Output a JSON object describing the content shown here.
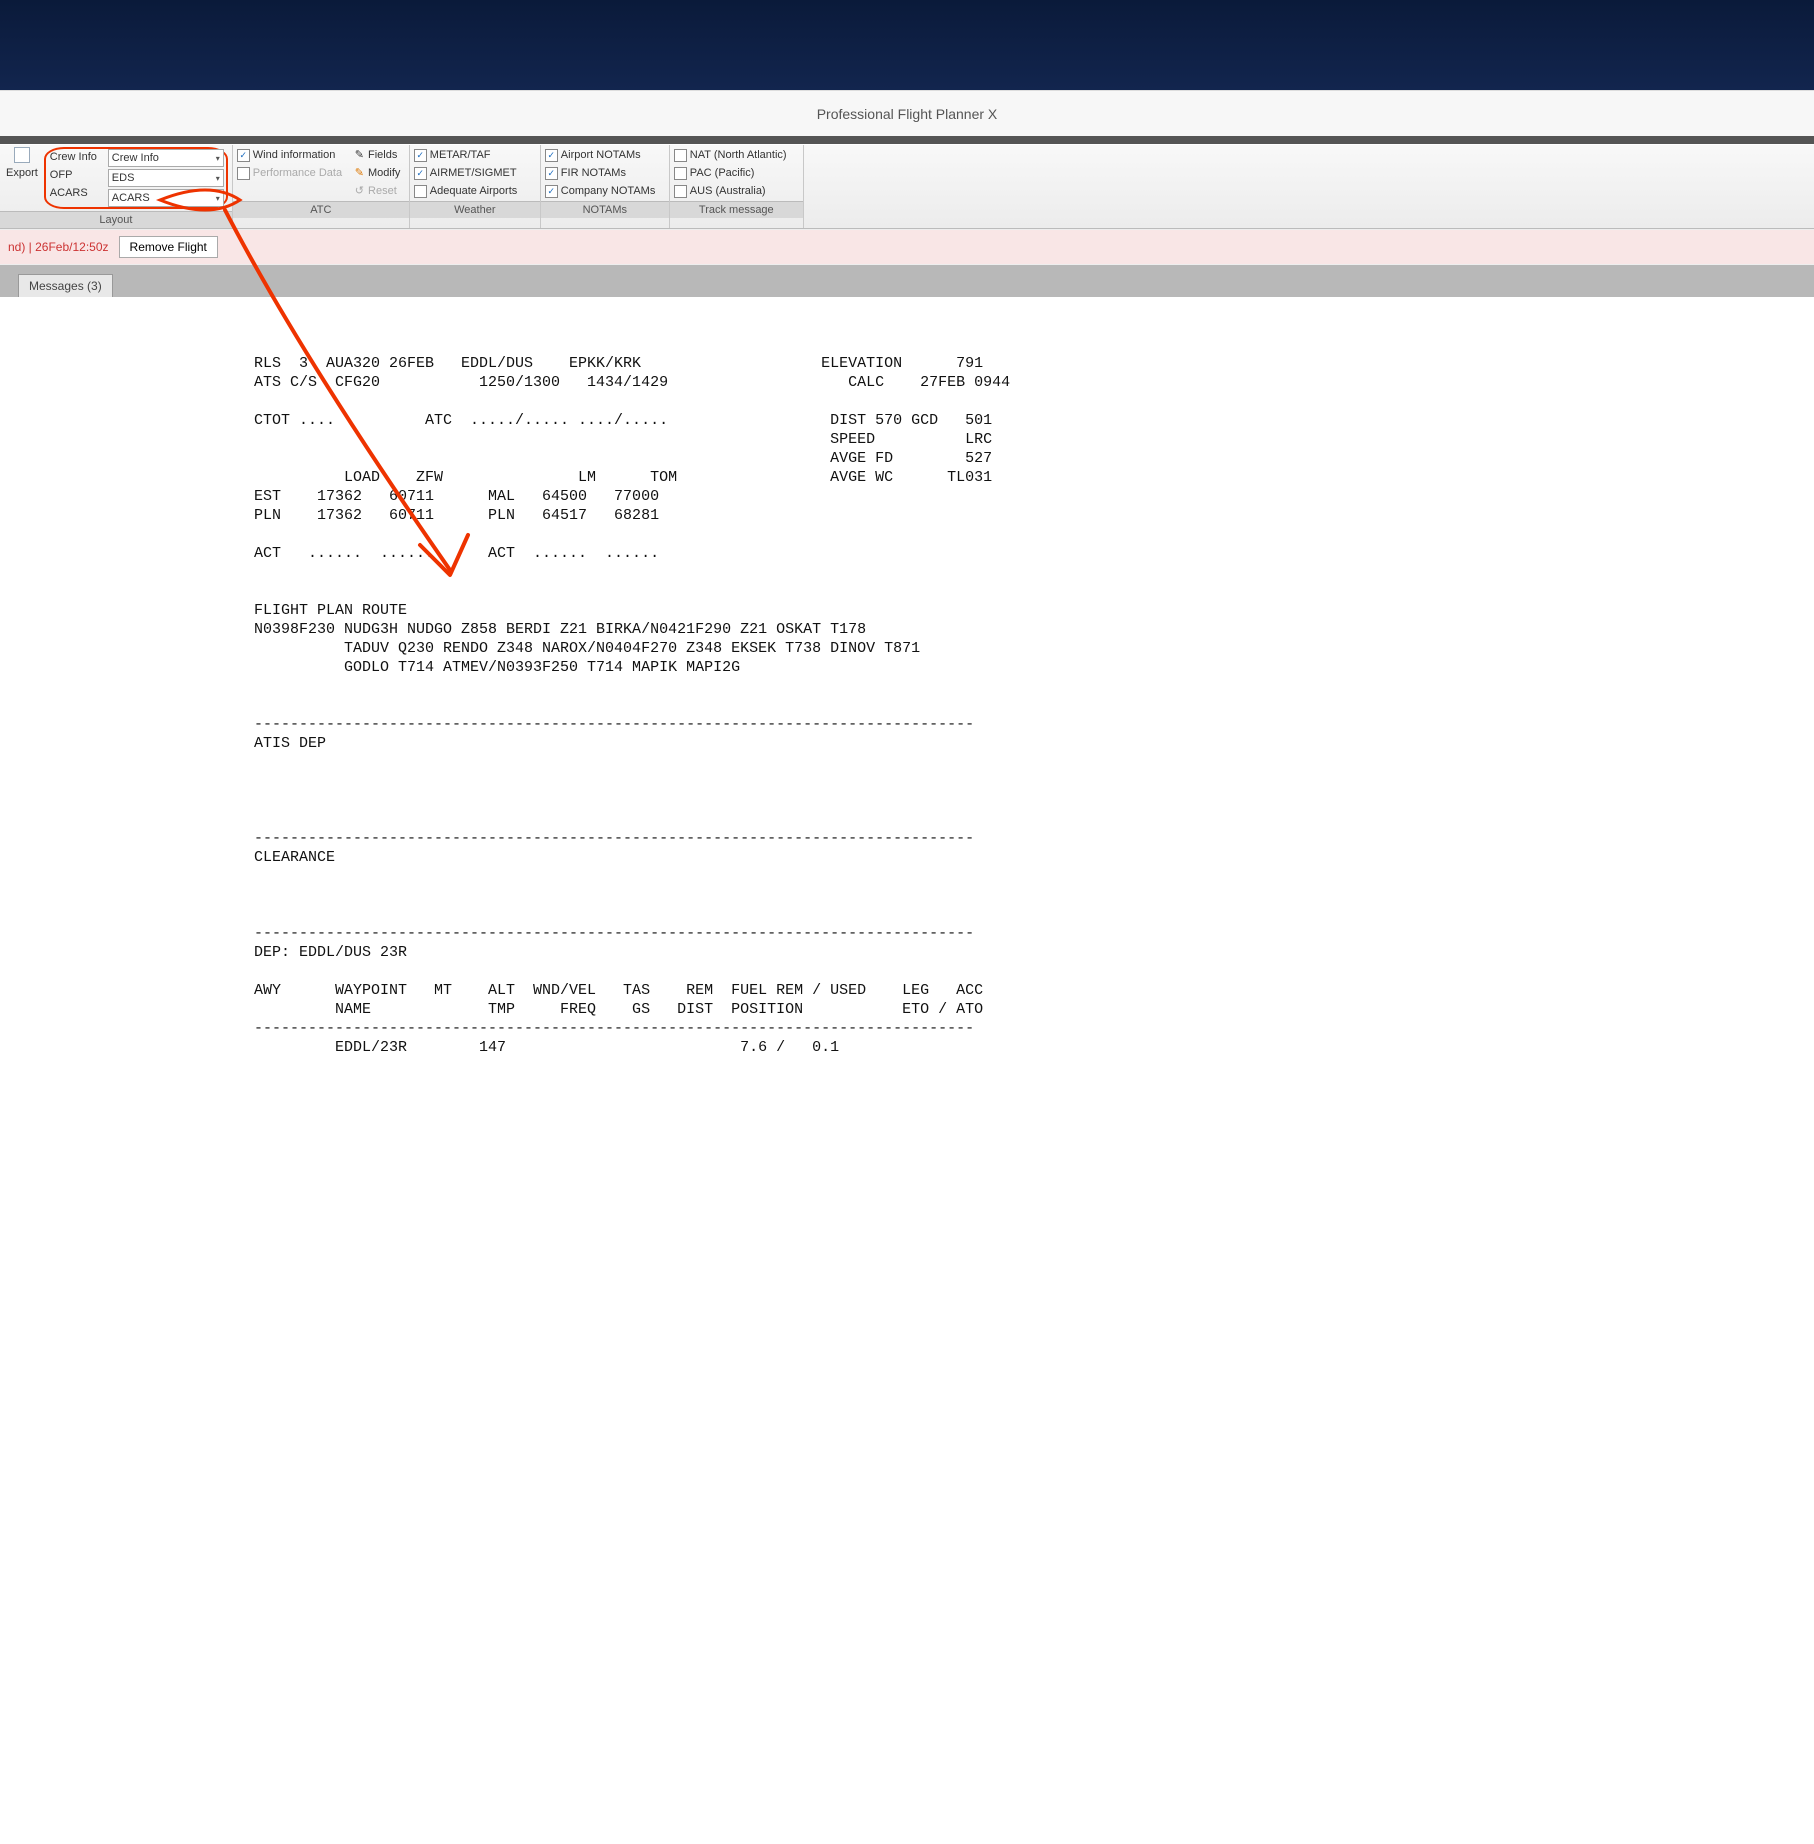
{
  "title": "Professional Flight Planner X",
  "ribbon": {
    "layout": {
      "export_label": "Export",
      "crewinfo_label": "Crew Info",
      "crewinfo_value": "Crew Info",
      "ofp_label": "OFP",
      "ofp_value": "EDS",
      "acars_label": "ACARS",
      "acars_value": "ACARS",
      "footer": "Layout"
    },
    "atc": {
      "wind": "Wind information",
      "perf": "Performance Data",
      "fields": "Fields",
      "modify": "Modify",
      "reset": "Reset",
      "footer": "ATC"
    },
    "weather": {
      "metar": "METAR/TAF",
      "airmet": "AIRMET/SIGMET",
      "adequate": "Adequate Airports",
      "footer": "Weather"
    },
    "notams": {
      "airport": "Airport NOTAMs",
      "fir": "FIR NOTAMs",
      "company": "Company NOTAMs",
      "footer": "NOTAMs"
    },
    "track": {
      "nat": "NAT (North Atlantic)",
      "pac": "PAC (Pacific)",
      "aus": "AUS (Australia)",
      "footer": "Track message"
    }
  },
  "status_bar": {
    "text": "nd) | 26Feb/12:50z",
    "remove": "Remove Flight"
  },
  "tab": "Messages (3)",
  "ofp_text": "RLS  3  AUA320 26FEB   EDDL/DUS    EPKK/KRK                    ELEVATION      791\nATS C/S  CFG20           1250/1300   1434/1429                    CALC    27FEB 0944\n\nCTOT ....          ATC  ...../..... ..../.....                  DIST 570 GCD   501\n                                                                SPEED          LRC\n                                                                AVGE FD        527\n          LOAD    ZFW               LM      TOM                 AVGE WC      TL031\nEST    17362   60711      MAL   64500   77000\nPLN    17362   60711      PLN   64517   68281\n\nACT   ......  ......      ACT  ......  ......\n\n\nFLIGHT PLAN ROUTE\nN0398F230 NUDG3H NUDGO Z858 BERDI Z21 BIRKA/N0421F290 Z21 OSKAT T178\n          TADUV Q230 RENDO Z348 NAROX/N0404F270 Z348 EKSEK T738 DINOV T871\n          GODLO T714 ATMEV/N0393F250 T714 MAPIK MAPI2G\n\n\n--------------------------------------------------------------------------------\nATIS DEP\n\n\n\n\n--------------------------------------------------------------------------------\nCLEARANCE\n\n\n\n--------------------------------------------------------------------------------\nDEP: EDDL/DUS 23R\n\nAWY      WAYPOINT   MT    ALT  WND/VEL   TAS    REM  FUEL REM / USED    LEG   ACC\n         NAME             TMP     FREQ    GS   DIST  POSITION           ETO / ATO\n--------------------------------------------------------------------------------\n         EDDL/23R        147                          7.6 /   0.1"
}
